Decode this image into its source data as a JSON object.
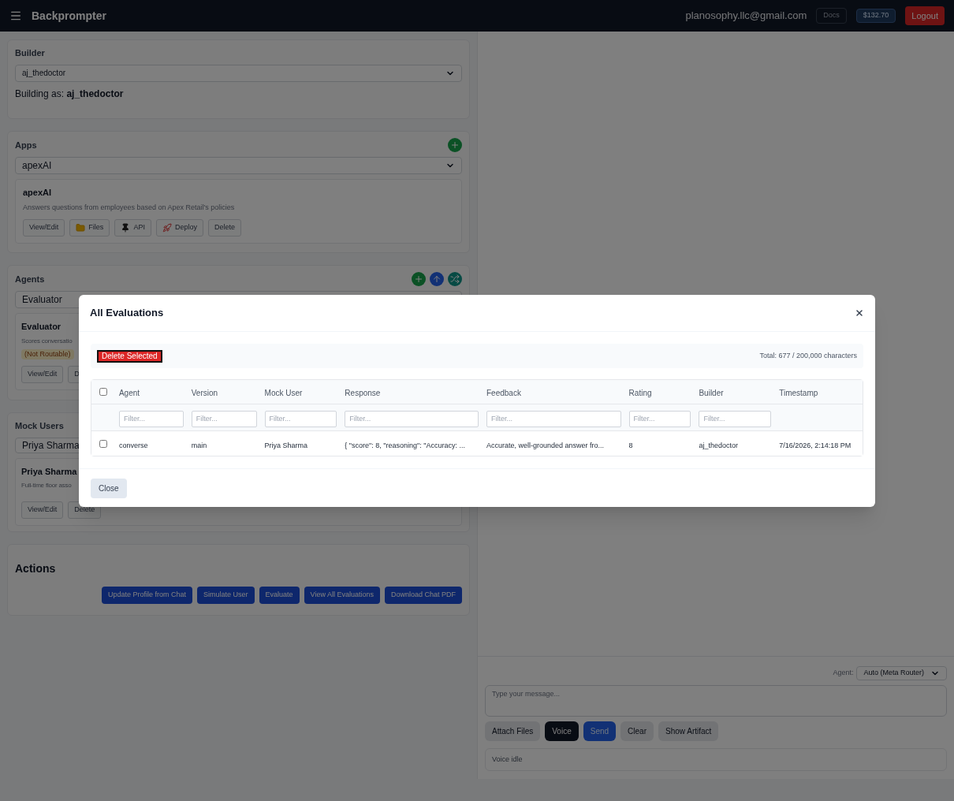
{
  "header": {
    "title": "Backprompter",
    "email": "planosophy.llc@gmail.com",
    "docs": "Docs",
    "balance": "$132.70",
    "logout": "Logout"
  },
  "builder": {
    "label": "Builder",
    "select_value": "aj_thedoctor",
    "building_as": "Building as: **aj_thedoctor**"
  },
  "apps": {
    "title": "Apps",
    "select_value": "apexAI",
    "card": {
      "name": "apexAI",
      "description": "Answers questions from employees based on Apex Retail's policies",
      "buttons": [
        {
          "label": "View/Edit",
          "kind": "plain"
        },
        {
          "label": "Files",
          "kind": "folder"
        },
        {
          "label": "API",
          "kind": "pin"
        },
        {
          "label": "Deploy",
          "kind": "rocket"
        },
        {
          "label": "Delete",
          "kind": "plain"
        }
      ]
    }
  },
  "agents": {
    "title": "Agents",
    "select_value": "Evaluator",
    "card": {
      "name": "Evaluator",
      "description": "Scores conversatio",
      "badge": "(Not Routable)",
      "buttons": [
        "View/Edit",
        "D"
      ]
    }
  },
  "mock_users": {
    "title": "Mock Users",
    "select_value": "Priya Sharma",
    "card": {
      "name": "Priya Sharma",
      "description": "Full-time floor asso",
      "buttons": [
        "View/Edit",
        "Delete"
      ]
    }
  },
  "actions": {
    "title": "Actions",
    "buttons": [
      "Update Profile from Chat",
      "Simulate User",
      "Evaluate",
      "View All Evaluations",
      "Download Chat PDF"
    ]
  },
  "chat": {
    "agent_label": "Agent:",
    "agent_select": "Auto (Meta Router)",
    "message_placeholder": "Type your message...",
    "buttons": [
      {
        "label": "Attach Files",
        "kind": "gray"
      },
      {
        "label": "Voice",
        "kind": "dark"
      },
      {
        "label": "Send",
        "kind": "primary"
      },
      {
        "label": "Clear",
        "kind": "gray"
      },
      {
        "label": "Show Artifact",
        "kind": "gray"
      }
    ],
    "voice_status": "Voice idle"
  },
  "modal": {
    "title": "All Evaluations",
    "delete_button": "Delete Selected",
    "total": "Total: 677 / 200,000 characters",
    "select_all_checked": false,
    "columns": [
      {
        "label": "Agent",
        "filter_placeholder": "Filter..."
      },
      {
        "label": "Version",
        "filter_placeholder": "Filter..."
      },
      {
        "label": "Mock User",
        "filter_placeholder": "Filter..."
      },
      {
        "label": "Response",
        "filter_placeholder": "Filter..."
      },
      {
        "label": "Feedback",
        "filter_placeholder": "Filter..."
      },
      {
        "label": "Rating",
        "filter_placeholder": "Filter..."
      },
      {
        "label": "Builder",
        "filter_placeholder": "Filter..."
      },
      {
        "label": "Timestamp"
      }
    ],
    "rows": [
      {
        "selected": false,
        "cells": [
          "converse",
          "main",
          "Priya Sharma",
          "{ \"score\": 8, \"reasoning\": \"Accuracy: ...",
          "Accurate, well-grounded answer fro...",
          "8",
          "aj_thedoctor",
          "7/16/2026, 2:14:18 PM"
        ]
      }
    ],
    "close_button": "Close"
  }
}
